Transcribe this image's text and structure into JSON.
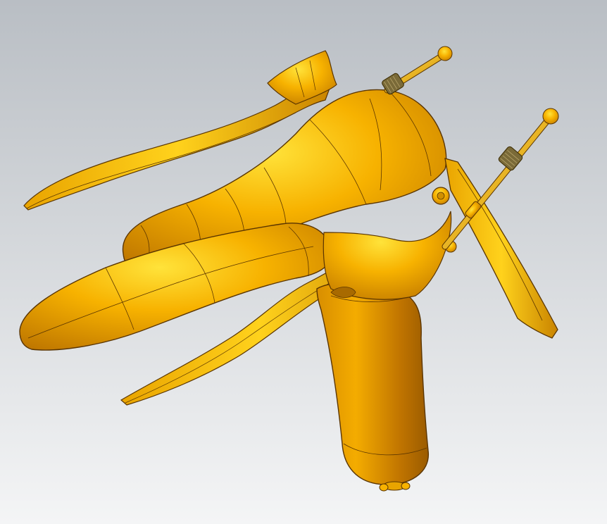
{
  "viewport": {
    "background_top": "#b9bec4",
    "background_bottom": "#f4f5f6",
    "model": {
      "name": "speculum-3d-model",
      "body_color": "#f7b200",
      "highlight_color": "#ffe33a",
      "shadow_color": "#c07800",
      "edge_color": "#5a3500",
      "knurl_color": "#6b5a2a"
    }
  }
}
